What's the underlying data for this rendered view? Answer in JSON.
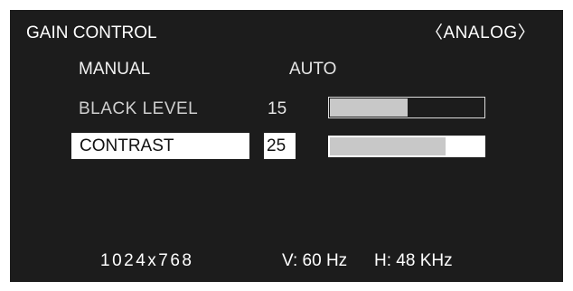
{
  "osd": {
    "title": "GAIN CONTROL",
    "input_mode": "〈ANALOG〉",
    "options": {
      "manual": "MANUAL",
      "auto": "AUTO"
    },
    "settings": [
      {
        "label": "BLACK LEVEL",
        "value": "15",
        "level": 0.5,
        "selected": false
      },
      {
        "label": "CONTRAST",
        "value": "25",
        "level": 0.75,
        "selected": true
      }
    ],
    "status": {
      "resolution": "1024x768",
      "v_freq": "V: 60 Hz",
      "h_freq": "H: 48 KHz"
    }
  },
  "colors": {
    "background": "#1c1c1c",
    "highlight": "#ffffff",
    "bar_fill": "#c8c8c8"
  }
}
